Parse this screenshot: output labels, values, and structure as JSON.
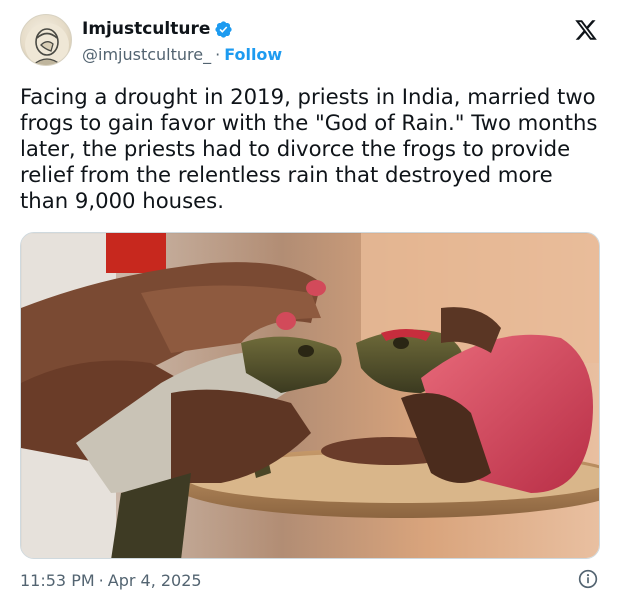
{
  "tweet": {
    "display_name": "Imjustculture",
    "handle": "@imjustculture_",
    "separator": "·",
    "follow_label": "Follow",
    "text": "Facing a drought in 2019, priests in India, married two frogs to gain favor with the \"God of Rain.\" Two months later, the priests had to divorce the frogs to provide relief from the relentless rain that destroyed more than 9,000 houses.",
    "time": "11:53 PM",
    "date": "Apr 4, 2025"
  },
  "icons": {
    "verified": "verified-badge-icon",
    "platform_logo": "x-logo-icon",
    "info": "info-icon"
  },
  "colors": {
    "accent": "#1d9bf0",
    "secondary_text": "#536471",
    "primary_text": "#0f1419"
  }
}
